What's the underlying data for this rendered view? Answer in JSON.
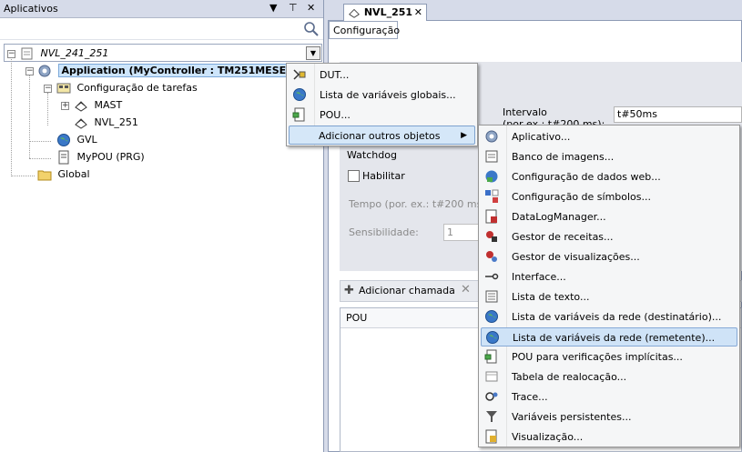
{
  "left_panel": {
    "title": "Aplicativos",
    "controls": [
      "▼",
      "⊤",
      "✕"
    ],
    "search": {
      "value": "",
      "placeholder": ""
    },
    "tree": {
      "root": "NVL_241_251",
      "application": "Application (MyController : TM251MESE)",
      "task_config": "Configuração de tarefas",
      "mast": "MAST",
      "nvl": "NVL_251",
      "gvl": "GVL",
      "mypou": "MyPOU (PRG)",
      "global": "Global"
    }
  },
  "editor": {
    "doc_tab": "NVL_251",
    "config_tab": "Configuração",
    "interval_label_1": "Intervalo",
    "interval_label_2": "(por ex.: t#200 ms):",
    "interval_value": "t#50ms",
    "watchdog_label": "Watchdog",
    "enable_label": "Habilitar",
    "time_label": "Tempo (por. ex.: t#200 ms):",
    "sensitivity_label": "Sensibilidade:",
    "sensitivity_value": "1",
    "add_call_label": "Adicionar chamada",
    "pou_header": "POU"
  },
  "context_menu": {
    "items": [
      {
        "label": "DUT...",
        "icon": "dut-icon"
      },
      {
        "label": "Lista de variáveis globais...",
        "icon": "globe-icon"
      },
      {
        "label": "POU...",
        "icon": "pou-icon"
      },
      {
        "label": "Adicionar outros objetos",
        "icon": "",
        "highlighted": true
      }
    ]
  },
  "submenu": {
    "items": [
      {
        "label": "Aplicativo...",
        "icon": "gear-icon"
      },
      {
        "label": "Banco de imagens...",
        "icon": "image-pool-icon"
      },
      {
        "label": "Configuração de dados web...",
        "icon": "web-data-icon"
      },
      {
        "label": "Configuração de símbolos...",
        "icon": "symbol-config-icon"
      },
      {
        "label": "DataLogManager...",
        "icon": "datalog-icon"
      },
      {
        "label": "Gestor de receitas...",
        "icon": "recipe-icon"
      },
      {
        "label": "Gestor de visualizações...",
        "icon": "visu-manager-icon"
      },
      {
        "label": "Interface...",
        "icon": "interface-icon"
      },
      {
        "label": "Lista de texto...",
        "icon": "text-list-icon"
      },
      {
        "label": "Lista de variáveis da rede (destinatário)...",
        "icon": "network-globe-icon"
      },
      {
        "label": "Lista de variáveis da rede (remetente)...",
        "icon": "network-globe-icon",
        "highlighted": true
      },
      {
        "label": "POU para verificações implícitas...",
        "icon": "pou-check-icon"
      },
      {
        "label": "Tabela de realocação...",
        "icon": "relocation-table-icon"
      },
      {
        "label": "Trace...",
        "icon": "trace-icon"
      },
      {
        "label": "Variáveis persistentes...",
        "icon": "persistent-vars-icon"
      },
      {
        "label": "Visualização...",
        "icon": "visualization-icon"
      }
    ]
  }
}
